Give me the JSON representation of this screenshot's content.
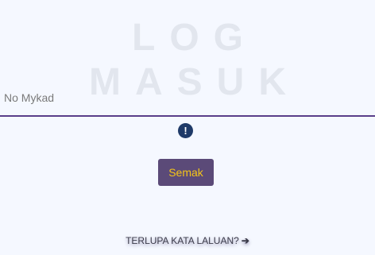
{
  "page": {
    "title": "LOG MASUK"
  },
  "form": {
    "mykad_placeholder": "No Mykad",
    "mykad_value": "",
    "alert_glyph": "!",
    "submit_label": "Semak"
  },
  "links": {
    "forgot_password_label": "TERLUPA KATA LALUAN?",
    "forgot_password_arrow": "➔"
  },
  "colors": {
    "background": "#f5f8ff",
    "title": "#e2e6ee",
    "field_underline": "#5a3e8a",
    "alert_icon": "#1f3a68",
    "button_bg": "#5b4a78",
    "button_text": "#f5c518"
  },
  "icons": {
    "alert": "exclamation-circle-icon",
    "link_arrow": "arrow-right-icon"
  }
}
